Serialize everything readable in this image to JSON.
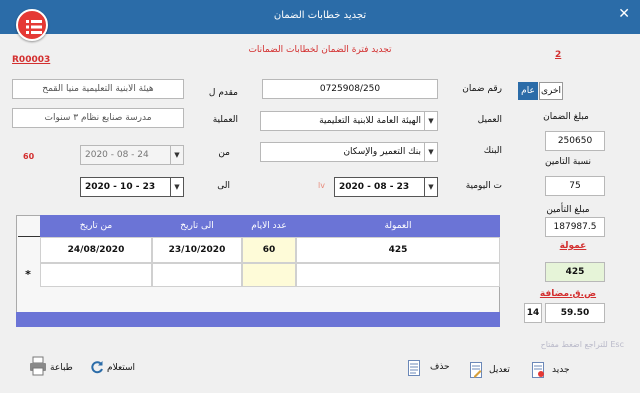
{
  "window": {
    "title": "تجديد خطابات الضمان",
    "close": "✕"
  },
  "form": {
    "header_title": "تجديد فترة الضمان لخطابات الضمانات",
    "record_no": "2",
    "code": "R00003",
    "tabs": {
      "general": "عام",
      "other": "اخرى"
    },
    "fields": {
      "guarantee_no": {
        "label": "رقم ضمان",
        "value": "0725908/250"
      },
      "client": {
        "label": "العميل",
        "value": "الهيئة العامة للابنية التعليمية"
      },
      "bank": {
        "label": "البنك",
        "value": "بنك التعمير والإسكان"
      },
      "daily_date": {
        "label": "ت اليومية",
        "value": "2020 - 08 - 23",
        "marker": "lv"
      },
      "applicant": {
        "label": "مقدم ل",
        "value": "هيئة الابنية التعليمية منيا القمح"
      },
      "operation": {
        "label": "العملية",
        "value": "مدرسة صنايع نظام ٣ سنوات"
      },
      "from": {
        "label": "من",
        "value": "2020 - 08 - 24",
        "badge": "60"
      },
      "to": {
        "label": "الى",
        "value": "2020 - 10 - 23"
      }
    },
    "right_panel": {
      "guarantee_amount_label": "مبلغ الضمان",
      "guarantee_amount": "250650",
      "insurance_pct_label": "نسبة التامين",
      "insurance_pct": "75",
      "insurance_amount_label": "مبلغ التأمين",
      "insurance_amount": "187987.5",
      "commission_label": "عمولة",
      "commission": "425",
      "vat_label": "ض.ق.مضافة",
      "vat_value": "59.50",
      "vat_rate": "14"
    },
    "grid": {
      "columns": [
        "العمولة",
        "عدد الايام",
        "الى تاريخ",
        "من تاريخ"
      ],
      "rows": [
        {
          "commission": "425",
          "days": "60",
          "to_date": "23/10/2020",
          "from_date": "24/08/2020"
        }
      ],
      "new_row_marker": "*"
    },
    "esc_hint": "للتراجع اضغط مفتاح Esc",
    "toolbar": {
      "print": "طباعة",
      "query": "استعلام",
      "delete": "حذف",
      "edit": "تعديل",
      "new": "جديد"
    }
  }
}
